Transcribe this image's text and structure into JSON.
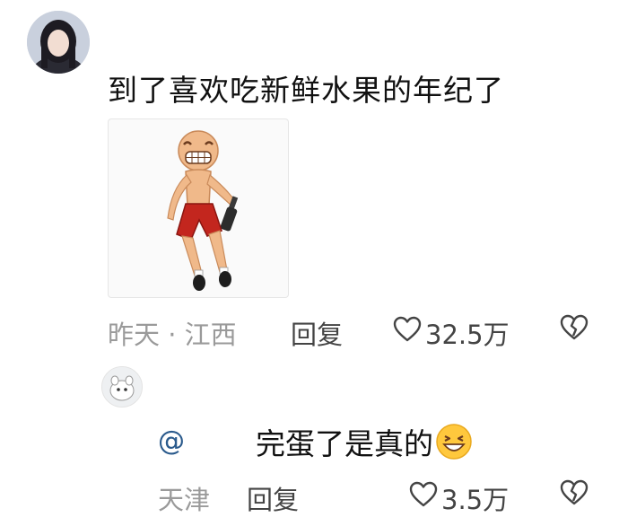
{
  "comment": {
    "text": "到了喜欢吃新鲜水果的年纪了",
    "meta_left": "昨天 · 江西",
    "reply_label": "回复",
    "likes": "32.5万",
    "sticker_icon": "dancing-cartoon-man-with-bottle"
  },
  "reply": {
    "mention": "@",
    "text": "完蛋了是真的",
    "emoji": "grinning-squinting-face",
    "location": "天津",
    "reply_label": "回复",
    "likes": "3.5万"
  },
  "colors": {
    "meta": "#9a9a9a",
    "mention": "#2a5a8c",
    "text": "#111111"
  }
}
